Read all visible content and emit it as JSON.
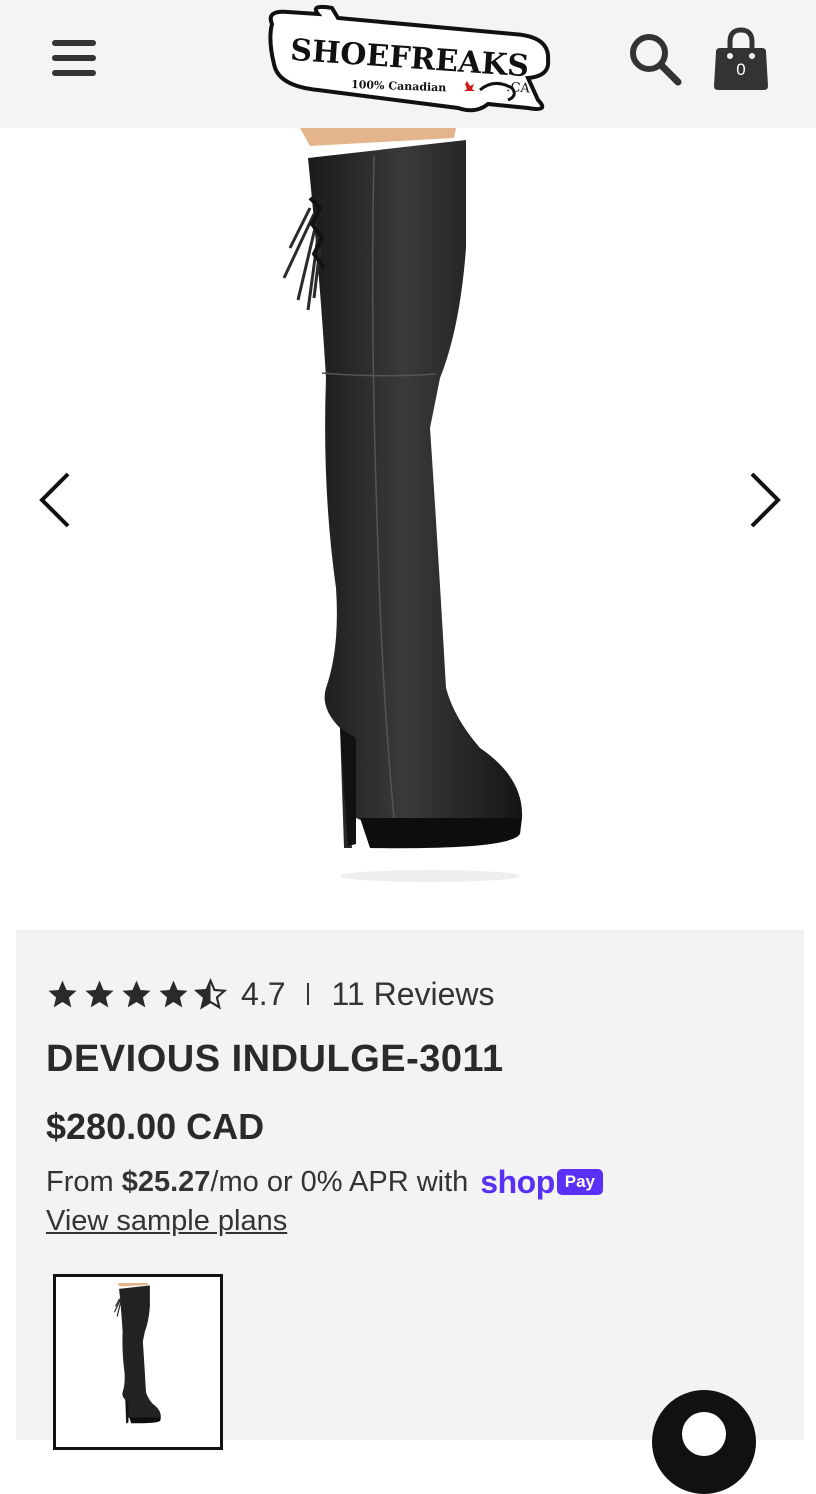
{
  "header": {
    "logo_text": "SHOEFREAKS",
    "logo_suffix": ".CA",
    "logo_tagline": "100% Canadian",
    "menu_icon": "hamburger-icon",
    "search_icon": "search-icon",
    "cart_icon": "shopping-bag-icon",
    "cart_count": "0"
  },
  "gallery": {
    "prev_icon": "chevron-left-icon",
    "next_icon": "chevron-right-icon"
  },
  "product": {
    "rating_stars": 4.5,
    "rating_value": "4.7",
    "reviews_label": "11 Reviews",
    "title": "DEVIOUS INDULGE-3011",
    "price": "$280.00 CAD",
    "installments": {
      "prefix": "From ",
      "amount": "$25.27",
      "suffix": "/mo or 0% APR with",
      "shop_word": "shop",
      "pay_badge": "Pay"
    },
    "view_plans": "View sample plans"
  },
  "colors": {
    "header_bg": "#f4f4f5",
    "info_bg": "#f3f3f4",
    "text": "#333333",
    "shop_pay": "#5a31f4"
  }
}
